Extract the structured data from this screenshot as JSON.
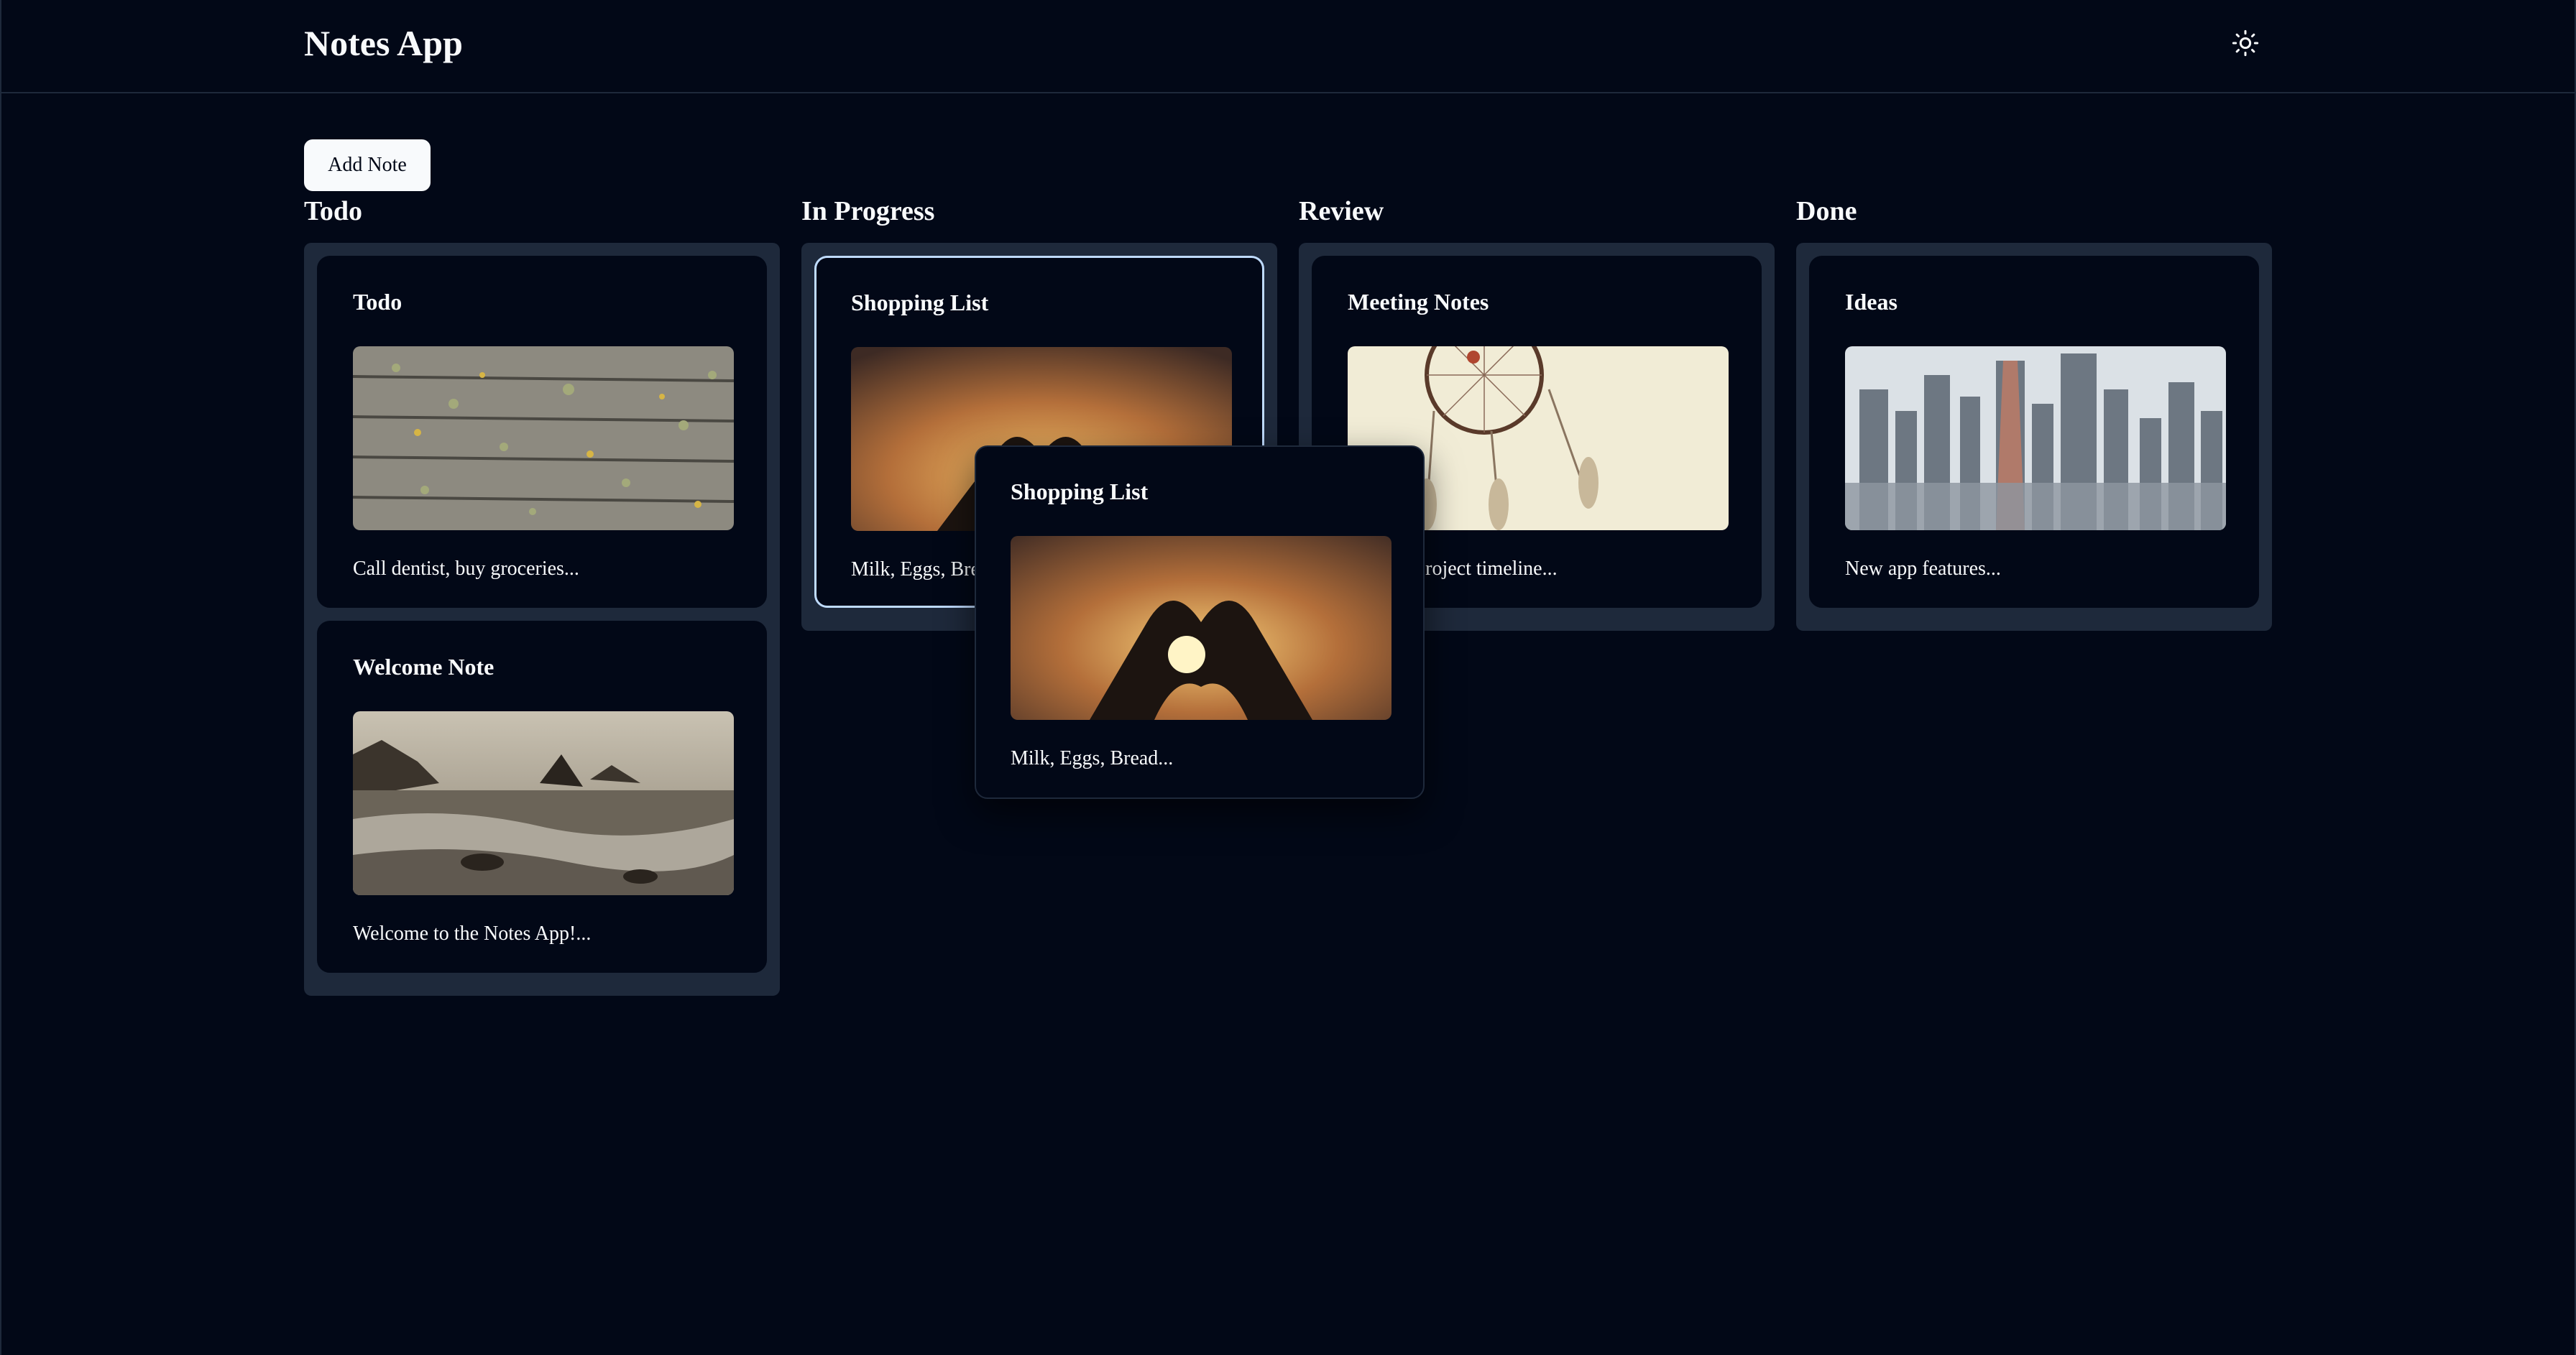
{
  "app": {
    "title": "Notes App",
    "theme_icon": "sun-icon"
  },
  "toolbar": {
    "add_label": "Add Note"
  },
  "columns": [
    {
      "title": "Todo",
      "notes": [
        {
          "title": "Todo",
          "preview": "Call dentist, buy groceries...",
          "image": "wooden-planks-with-leaves"
        },
        {
          "title": "Welcome Note",
          "preview": "Welcome to the Notes App!...",
          "image": "rocky-beach-waves"
        }
      ]
    },
    {
      "title": "In Progress",
      "notes": [
        {
          "title": "Shopping List",
          "preview": "Milk, Eggs, Bread...",
          "image": "heart-hands-sunset"
        }
      ]
    },
    {
      "title": "Review",
      "notes": [
        {
          "title": "Meeting Notes",
          "preview": "Discuss project timeline...",
          "image": "dreamcatcher"
        }
      ]
    },
    {
      "title": "Done",
      "notes": [
        {
          "title": "Ideas",
          "preview": "New app features...",
          "image": "city-skyline"
        }
      ]
    }
  ],
  "drag_preview": {
    "title": "Shopping List",
    "preview": "Milk, Eggs, Bread...",
    "image": "heart-hands-sunset"
  },
  "colors": {
    "background": "#020817",
    "column": "#1e293b",
    "selected_border": "#bfdbfe",
    "text": "#f8fafc"
  }
}
